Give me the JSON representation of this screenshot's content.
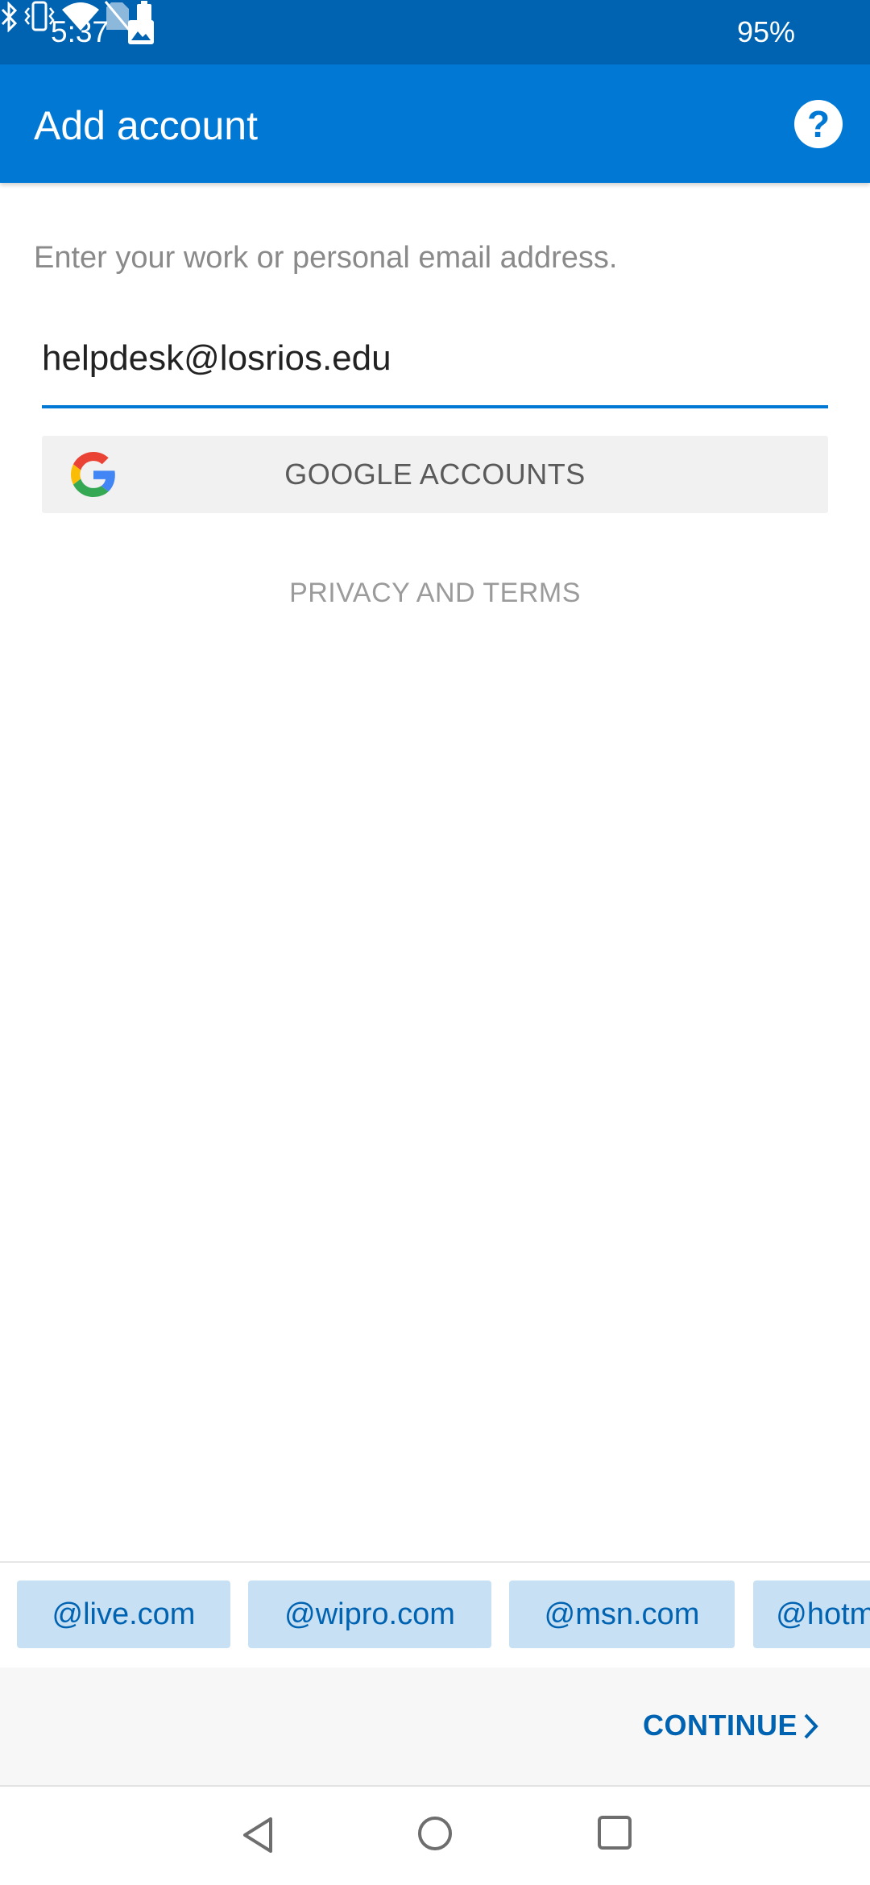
{
  "status_bar": {
    "time": "5:37",
    "battery": "95%",
    "icons": [
      "image-icon",
      "bluetooth-icon",
      "vibrate-icon",
      "wifi-icon",
      "no-sim-icon",
      "battery-icon"
    ]
  },
  "app_bar": {
    "title": "Add account",
    "help_icon": "help-icon",
    "help_glyph": "?"
  },
  "form": {
    "instructions": "Enter your work or personal email address.",
    "email_value": "helpdesk@losrios.edu"
  },
  "google_button": {
    "label": "GOOGLE ACCOUNTS",
    "icon": "google-g-icon"
  },
  "privacy": {
    "label": "PRIVACY AND TERMS"
  },
  "suggestions": [
    "@live.com",
    "@wipro.com",
    "@msn.com",
    "@hotmail.com"
  ],
  "footer": {
    "continue_label": "CONTINUE",
    "continue_icon": "chevron-right-icon"
  },
  "nav": {
    "icons": [
      "back-icon",
      "home-icon",
      "recents-icon"
    ]
  },
  "colors": {
    "status_bar": "#0063b1",
    "app_bar": "#0078d4",
    "accent": "#0078d4",
    "chip_bg": "#c7e0f4",
    "chip_text": "#0063b1"
  }
}
